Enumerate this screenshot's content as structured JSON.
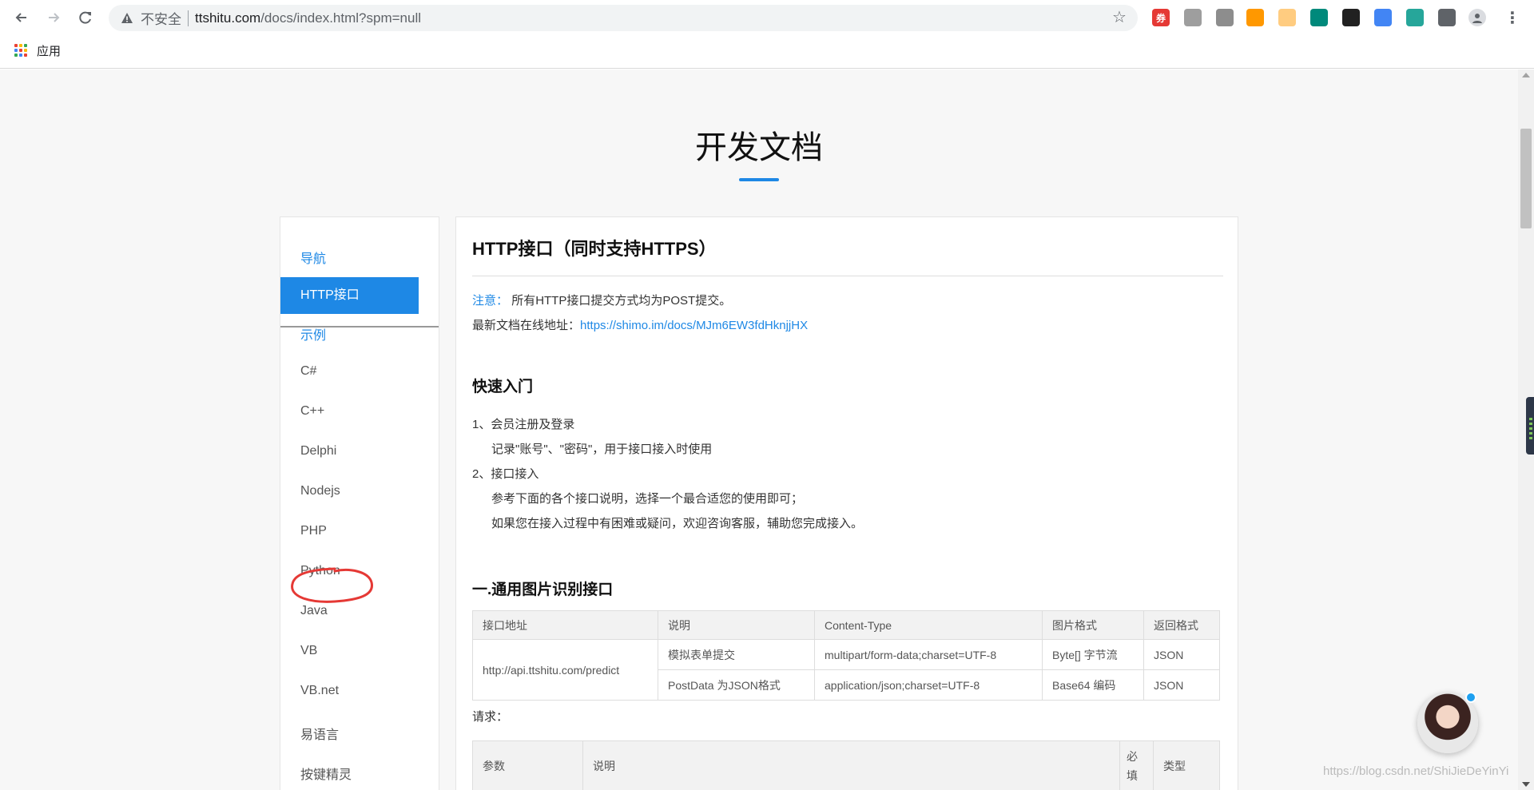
{
  "browser": {
    "insecure_label": "不安全",
    "url_host": "ttshitu.com",
    "url_path": "/docs/index.html?spm=null",
    "bookmarks_apps_label": "应用",
    "extensions": [
      {
        "name": "coupon-extension-icon",
        "text": "券",
        "color": "#e53935"
      },
      {
        "name": "shield-extension-icon",
        "text": "",
        "color": "#9e9e9e"
      },
      {
        "name": "ticket-extension-icon",
        "text": "",
        "color": "#8d8d8d"
      },
      {
        "name": "lock-extension-icon",
        "text": "",
        "color": "#ff9800"
      },
      {
        "name": "cat-extension-icon",
        "text": "",
        "color": "#ffcc80"
      },
      {
        "name": "map-extension-icon",
        "text": "",
        "color": "#00897b"
      },
      {
        "name": "swirl-extension-icon",
        "text": "",
        "color": "#212121"
      },
      {
        "name": "chrome-extension-icon",
        "text": "",
        "color": "#4285f4"
      },
      {
        "name": "image-search-extension-icon",
        "text": "",
        "color": "#26a69a"
      },
      {
        "name": "puzzle-extension-icon",
        "text": "",
        "color": "#5f6368"
      }
    ]
  },
  "page": {
    "title": "开发文档",
    "sidebar": {
      "nav_head": "导航",
      "active_item": "HTTP接口",
      "examples_head": "示例",
      "items": [
        "C#",
        "C++",
        "Delphi",
        "Nodejs",
        "PHP",
        "Python",
        "Java",
        "VB",
        "VB.net",
        "易语言",
        "按键精灵"
      ]
    },
    "content": {
      "h1": "HTTP接口（同时支持HTTPS）",
      "note_label": "注意：",
      "note_text": "所有HTTP接口提交方式均为POST提交。",
      "doc_label": "最新文档在线地址：",
      "doc_link": "https://shimo.im/docs/MJm6EW3fdHknjjHX",
      "quick_start": "快速入门",
      "step1": "1、会员注册及登录",
      "step1_desc": "记录\"账号\"、\"密码\"，用于接口接入时使用",
      "step2": "2、接口接入",
      "step2_desc1": "参考下面的各个接口说明，选择一个最合适您的使用即可；",
      "step2_desc2": "如果您在接入过程中有困难或疑问，欢迎咨询客服，辅助您完成接入。",
      "section1": "一.通用图片识别接口",
      "api_table": {
        "headers": [
          "接口地址",
          "说明",
          "Content-Type",
          "图片格式",
          "返回格式"
        ],
        "endpoint": "http://api.ttshitu.com/predict",
        "rows": [
          [
            "模拟表单提交",
            "multipart/form-data;charset=UTF-8",
            "Byte[] 字节流",
            "JSON"
          ],
          [
            "PostData 为JSON格式",
            "application/json;charset=UTF-8",
            "Base64 编码",
            "JSON"
          ]
        ]
      },
      "request_label": "请求：",
      "params_headers": [
        "参数",
        "说明",
        "必填",
        "类型"
      ]
    },
    "watermark": "https://blog.csdn.net/ShiJieDeYinYi"
  }
}
